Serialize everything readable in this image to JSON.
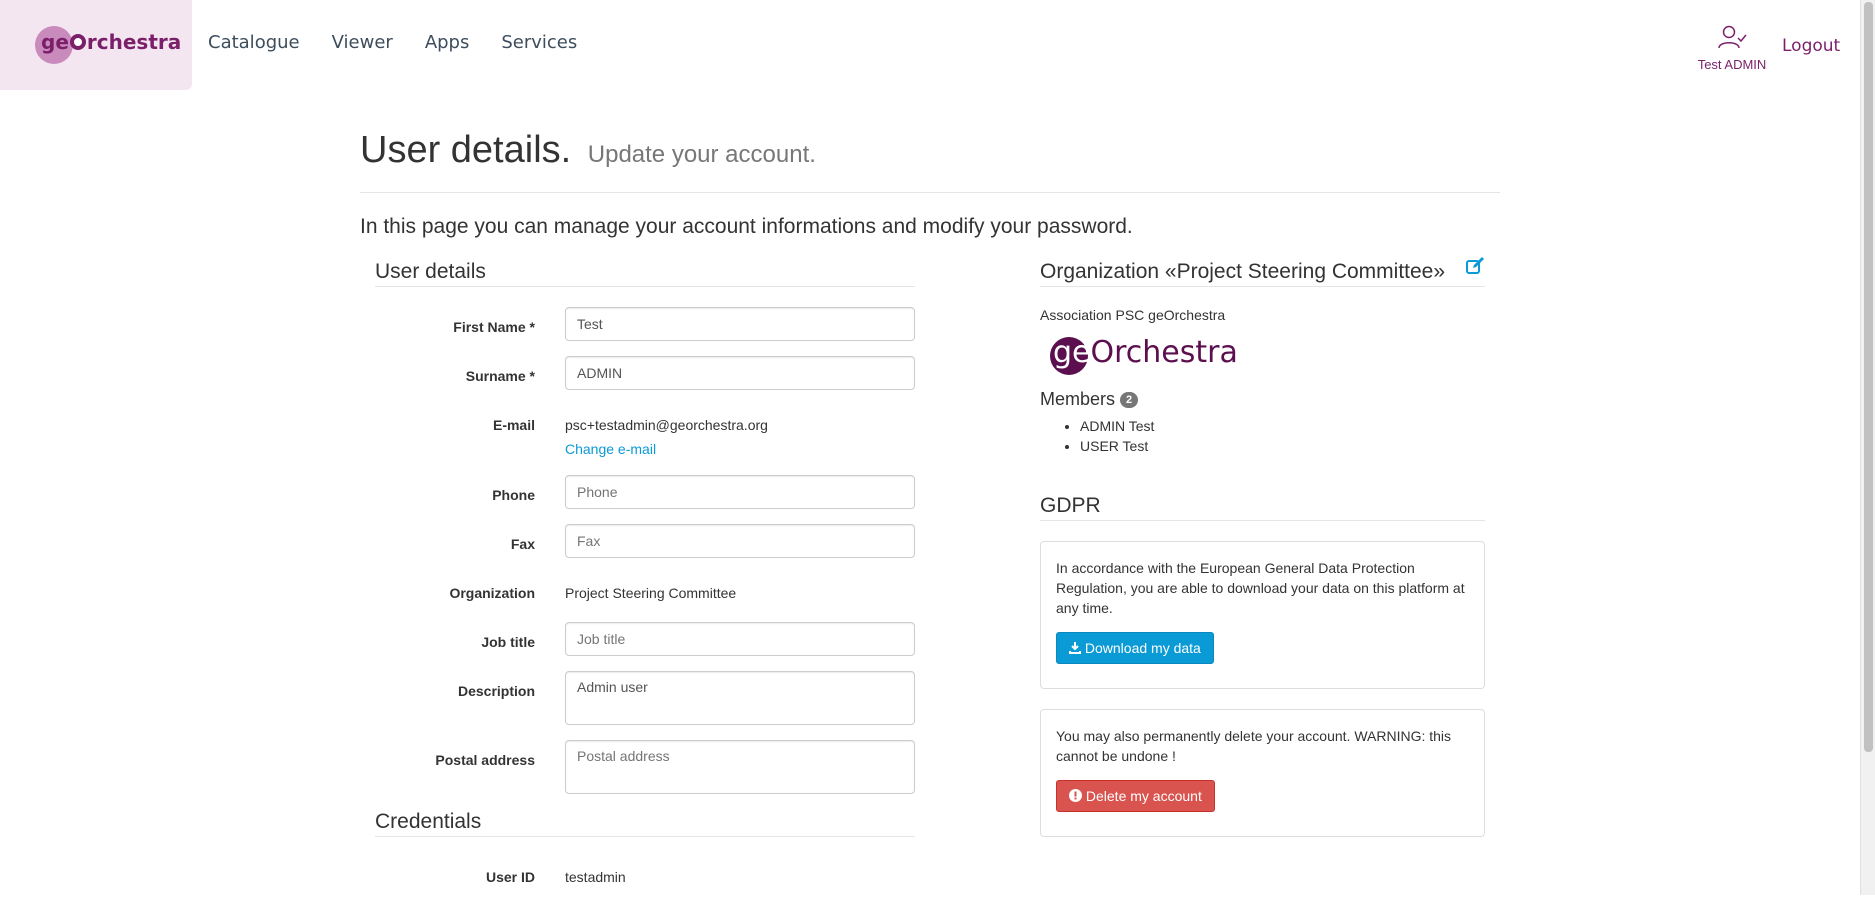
{
  "header": {
    "logo_prefix": "ge",
    "logo_suffix": "rchestra",
    "nav": [
      "Catalogue",
      "Viewer",
      "Apps",
      "Services"
    ],
    "user_name": "Test ADMIN",
    "logout_label": "Logout"
  },
  "page": {
    "title": "User details.",
    "subtitle": "Update your account.",
    "lead": "In this page you can manage your account informations and modify your password."
  },
  "user_details": {
    "section_title": "User details",
    "first_name": {
      "label": "First Name *",
      "value": "Test"
    },
    "surname": {
      "label": "Surname *",
      "value": "ADMIN"
    },
    "email": {
      "label": "E-mail",
      "value": "psc+testadmin@georchestra.org",
      "change_label": "Change e-mail"
    },
    "phone": {
      "label": "Phone",
      "placeholder": "Phone"
    },
    "fax": {
      "label": "Fax",
      "placeholder": "Fax"
    },
    "organization": {
      "label": "Organization",
      "value": "Project Steering Committee"
    },
    "job_title": {
      "label": "Job title",
      "placeholder": "Job title"
    },
    "description": {
      "label": "Description",
      "value": "Admin user"
    },
    "postal_address": {
      "label": "Postal address",
      "placeholder": "Postal address"
    }
  },
  "credentials": {
    "section_title": "Credentials",
    "user_id": {
      "label": "User ID",
      "value": "testadmin"
    }
  },
  "organization_panel": {
    "title": "Organization «Project Steering Committee»",
    "description": "Association PSC geOrchestra",
    "logo_prefix": "ge",
    "logo_suffix": "Orchestra",
    "members_label": "Members",
    "members_count": "2",
    "members": [
      "ADMIN Test",
      "USER Test"
    ]
  },
  "gdpr": {
    "section_title": "GDPR",
    "download_text": "In accordance with the European General Data Protection Regulation, you are able to download your data on this platform at any time.",
    "download_label": "Download my data",
    "delete_text": "You may also permanently delete your account. WARNING: this cannot be undone !",
    "delete_label": "Delete my account"
  },
  "colors": {
    "brand": "#7b1f6a",
    "link": "#0a9ad6",
    "danger": "#d9534f"
  }
}
